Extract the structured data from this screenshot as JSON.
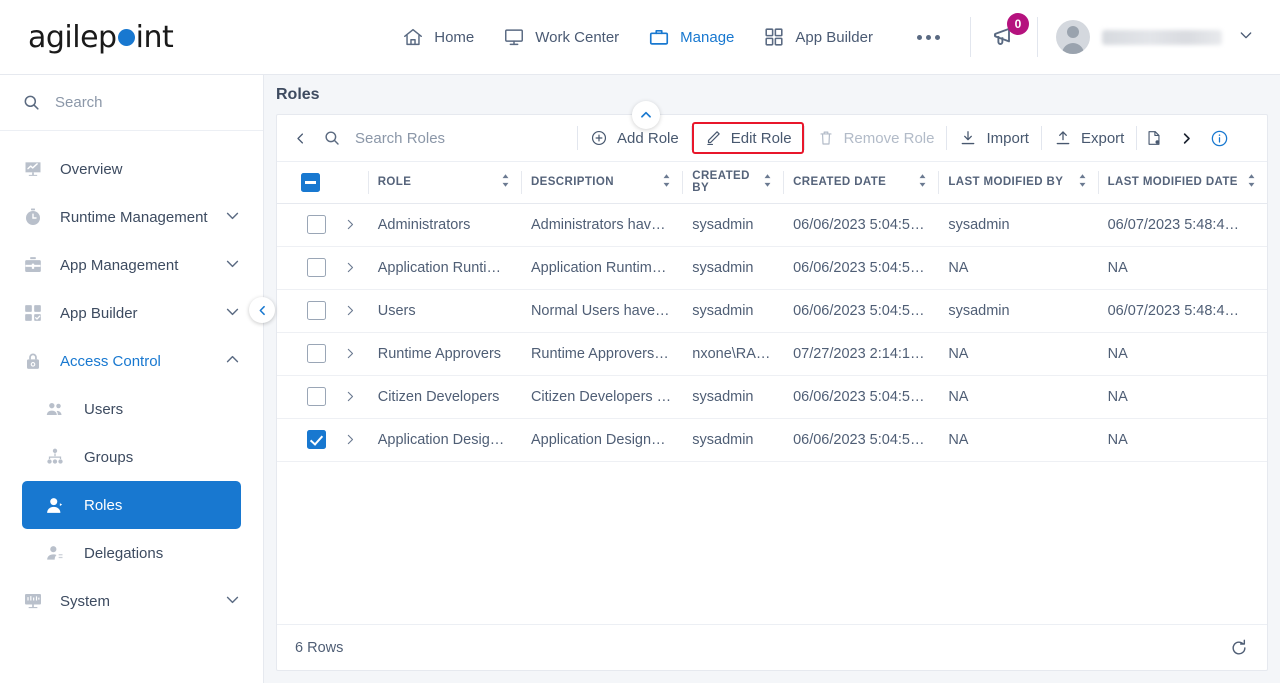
{
  "header": {
    "logo_text_a": "agilep",
    "logo_text_b": "int",
    "logo_dot_color": "#1878d0",
    "nav": [
      {
        "label": "Home",
        "icon": "home-icon",
        "active": false
      },
      {
        "label": "Work Center",
        "icon": "monitor-icon",
        "active": false
      },
      {
        "label": "Manage",
        "icon": "briefcase-icon",
        "active": true
      },
      {
        "label": "App Builder",
        "icon": "grid-icon",
        "active": false
      }
    ],
    "overflow_label": "More",
    "notification": {
      "icon": "megaphone-icon",
      "badge_count": "0",
      "badge_color": "#b5127e"
    },
    "user": {
      "name": "",
      "avatar": "avatar-icon",
      "caret": "chevron-down-icon"
    }
  },
  "sidebar": {
    "search_placeholder": "Search",
    "search_value": "",
    "items": [
      {
        "label": "Overview",
        "icon": "chart-monitor-icon",
        "expandable": false,
        "accent": false
      },
      {
        "label": "Runtime Management",
        "icon": "stopwatch-icon",
        "expandable": true,
        "expanded": false,
        "accent": false
      },
      {
        "label": "App Management",
        "icon": "toolbox-icon",
        "expandable": true,
        "expanded": false,
        "accent": false
      },
      {
        "label": "App Builder",
        "icon": "grid-check-icon",
        "expandable": true,
        "expanded": false,
        "accent": false
      },
      {
        "label": "Access Control",
        "icon": "lock-icon",
        "expandable": true,
        "expanded": true,
        "accent": true
      }
    ],
    "sub_items": [
      {
        "label": "Users",
        "icon": "users-icon",
        "selected": false
      },
      {
        "label": "Groups",
        "icon": "group-tree-icon",
        "selected": false
      },
      {
        "label": "Roles",
        "icon": "role-user-icon",
        "selected": true
      },
      {
        "label": "Delegations",
        "icon": "delegation-user-icon",
        "selected": false
      }
    ],
    "items_after": [
      {
        "label": "System",
        "icon": "system-monitor-icon",
        "expandable": true,
        "expanded": false,
        "accent": false
      }
    ],
    "collapse_handle": "chevron-left-icon",
    "selected_color": "#1878d0"
  },
  "main": {
    "page_title": "Roles",
    "panel_collapse_icon": "chevron-up-icon",
    "toolbar": {
      "back_icon": "chevron-left-icon",
      "search_placeholder": "Search Roles",
      "search_value": "",
      "buttons": [
        {
          "label": "Add Role",
          "icon": "plus-circle-icon",
          "disabled": false,
          "highlighted": false
        },
        {
          "label": "Edit Role",
          "icon": "pencil-icon",
          "disabled": false,
          "highlighted": true
        },
        {
          "label": "Remove Role",
          "icon": "trash-icon",
          "disabled": true,
          "highlighted": false
        },
        {
          "label": "Import",
          "icon": "download-icon",
          "disabled": false,
          "highlighted": false
        },
        {
          "label": "Export",
          "icon": "upload-icon",
          "disabled": false,
          "highlighted": false
        }
      ],
      "report_icon": "report-document-icon",
      "next_icon": "chevron-right-icon",
      "info_icon": "info-circle-icon",
      "highlight_color": "#e8172b"
    },
    "table": {
      "select_all_state": "indeterminate",
      "columns": [
        {
          "label": "ROLE",
          "sortable": true
        },
        {
          "label": "DESCRIPTION",
          "sortable": true
        },
        {
          "label": "CREATED BY",
          "sortable": true
        },
        {
          "label": "CREATED DATE",
          "sortable": true
        },
        {
          "label": "LAST MODIFIED BY",
          "sortable": true
        },
        {
          "label": "LAST MODIFIED DATE",
          "sortable": true
        }
      ],
      "rows": [
        {
          "checked": false,
          "role": "Administrators",
          "description": "Administrators hav…",
          "created_by": "sysadmin",
          "created_date": "06/06/2023 5:04:5…",
          "last_modified_by": "sysadmin",
          "last_modified_date": "06/07/2023 5:48:4…"
        },
        {
          "checked": false,
          "role": "Application Runtim…",
          "description": "Application Runtim…",
          "created_by": "sysadmin",
          "created_date": "06/06/2023 5:04:5…",
          "last_modified_by": "NA",
          "last_modified_date": "NA"
        },
        {
          "checked": false,
          "role": "Users",
          "description": "Normal Users have…",
          "created_by": "sysadmin",
          "created_date": "06/06/2023 5:04:5…",
          "last_modified_by": "sysadmin",
          "last_modified_date": "06/07/2023 5:48:4…"
        },
        {
          "checked": false,
          "role": "Runtime Approvers",
          "description": "Runtime Approvers…",
          "created_by": "nxone\\RA…",
          "created_date": "07/27/2023 2:14:1…",
          "last_modified_by": "NA",
          "last_modified_date": "NA"
        },
        {
          "checked": false,
          "role": "Citizen Developers",
          "description": "Citizen Developers …",
          "created_by": "sysadmin",
          "created_date": "06/06/2023 5:04:5…",
          "last_modified_by": "NA",
          "last_modified_date": "NA"
        },
        {
          "checked": true,
          "role": "Application Design…",
          "description": "Application Design…",
          "created_by": "sysadmin",
          "created_date": "06/06/2023 5:04:5…",
          "last_modified_by": "NA",
          "last_modified_date": "NA"
        }
      ]
    },
    "footer": {
      "row_count_label": "6 Rows",
      "refresh_icon": "refresh-icon"
    }
  }
}
